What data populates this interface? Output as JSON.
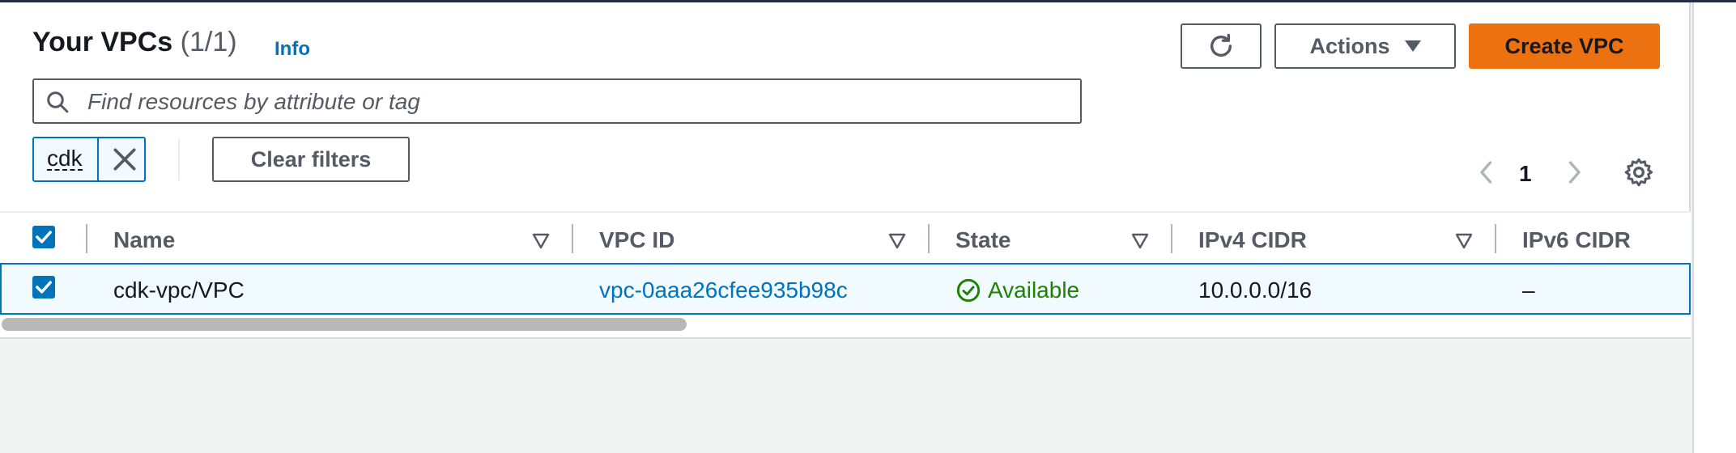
{
  "header": {
    "title": "Your VPCs",
    "count": "(1/1)",
    "info_link": "Info"
  },
  "toolbar": {
    "refresh_icon": "refresh-icon",
    "actions_label": "Actions",
    "create_label": "Create VPC"
  },
  "search": {
    "placeholder": "Find resources by attribute or tag",
    "value": ""
  },
  "filters": {
    "tokens": [
      {
        "label": "cdk"
      }
    ],
    "clear_label": "Clear filters"
  },
  "pagination": {
    "current_page": "1"
  },
  "table": {
    "columns": [
      {
        "label": "Name"
      },
      {
        "label": "VPC ID"
      },
      {
        "label": "State"
      },
      {
        "label": "IPv4 CIDR"
      },
      {
        "label": "IPv6 CIDR"
      }
    ],
    "rows": [
      {
        "selected": true,
        "name": "cdk-vpc/VPC",
        "vpc_id": "vpc-0aaa26cfee935b98c",
        "state": "Available",
        "ipv4_cidr": "10.0.0.0/16",
        "ipv6_cidr": "–"
      }
    ]
  },
  "colors": {
    "primary": "#ec7211",
    "link": "#0073bb",
    "success": "#1d8102",
    "text": "#16191f",
    "secondary_text": "#545b64"
  }
}
